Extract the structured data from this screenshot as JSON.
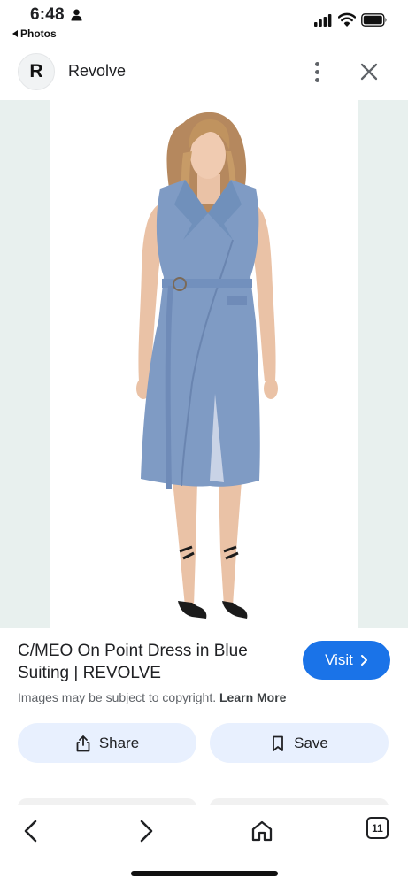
{
  "status_bar": {
    "time": "6:48",
    "back_app": "Photos"
  },
  "header": {
    "avatar_letter": "R",
    "site_name": "Revolve"
  },
  "result": {
    "title": "C/MEO On Point Dress in Blue Suiting | REVOLVE",
    "visit_label": "Visit",
    "copyright_text": "Images may be subject to copyright.",
    "learn_more": "Learn More"
  },
  "actions": {
    "share_label": "Share",
    "save_label": "Save"
  },
  "bottom_nav": {
    "tab_count": "11"
  },
  "icons": [
    "person-icon",
    "signal-icon",
    "wifi-icon",
    "battery-icon",
    "more-vert-icon",
    "close-icon",
    "chevron-right-icon",
    "share-icon",
    "bookmark-icon",
    "back-arrow-icon",
    "forward-arrow-icon",
    "home-icon",
    "tabs-icon"
  ],
  "colors": {
    "accent": "#1a73e8",
    "action_bg": "#e8f0fe",
    "image_bg": "#e8f0ee",
    "dress": "#7f9bc4"
  }
}
